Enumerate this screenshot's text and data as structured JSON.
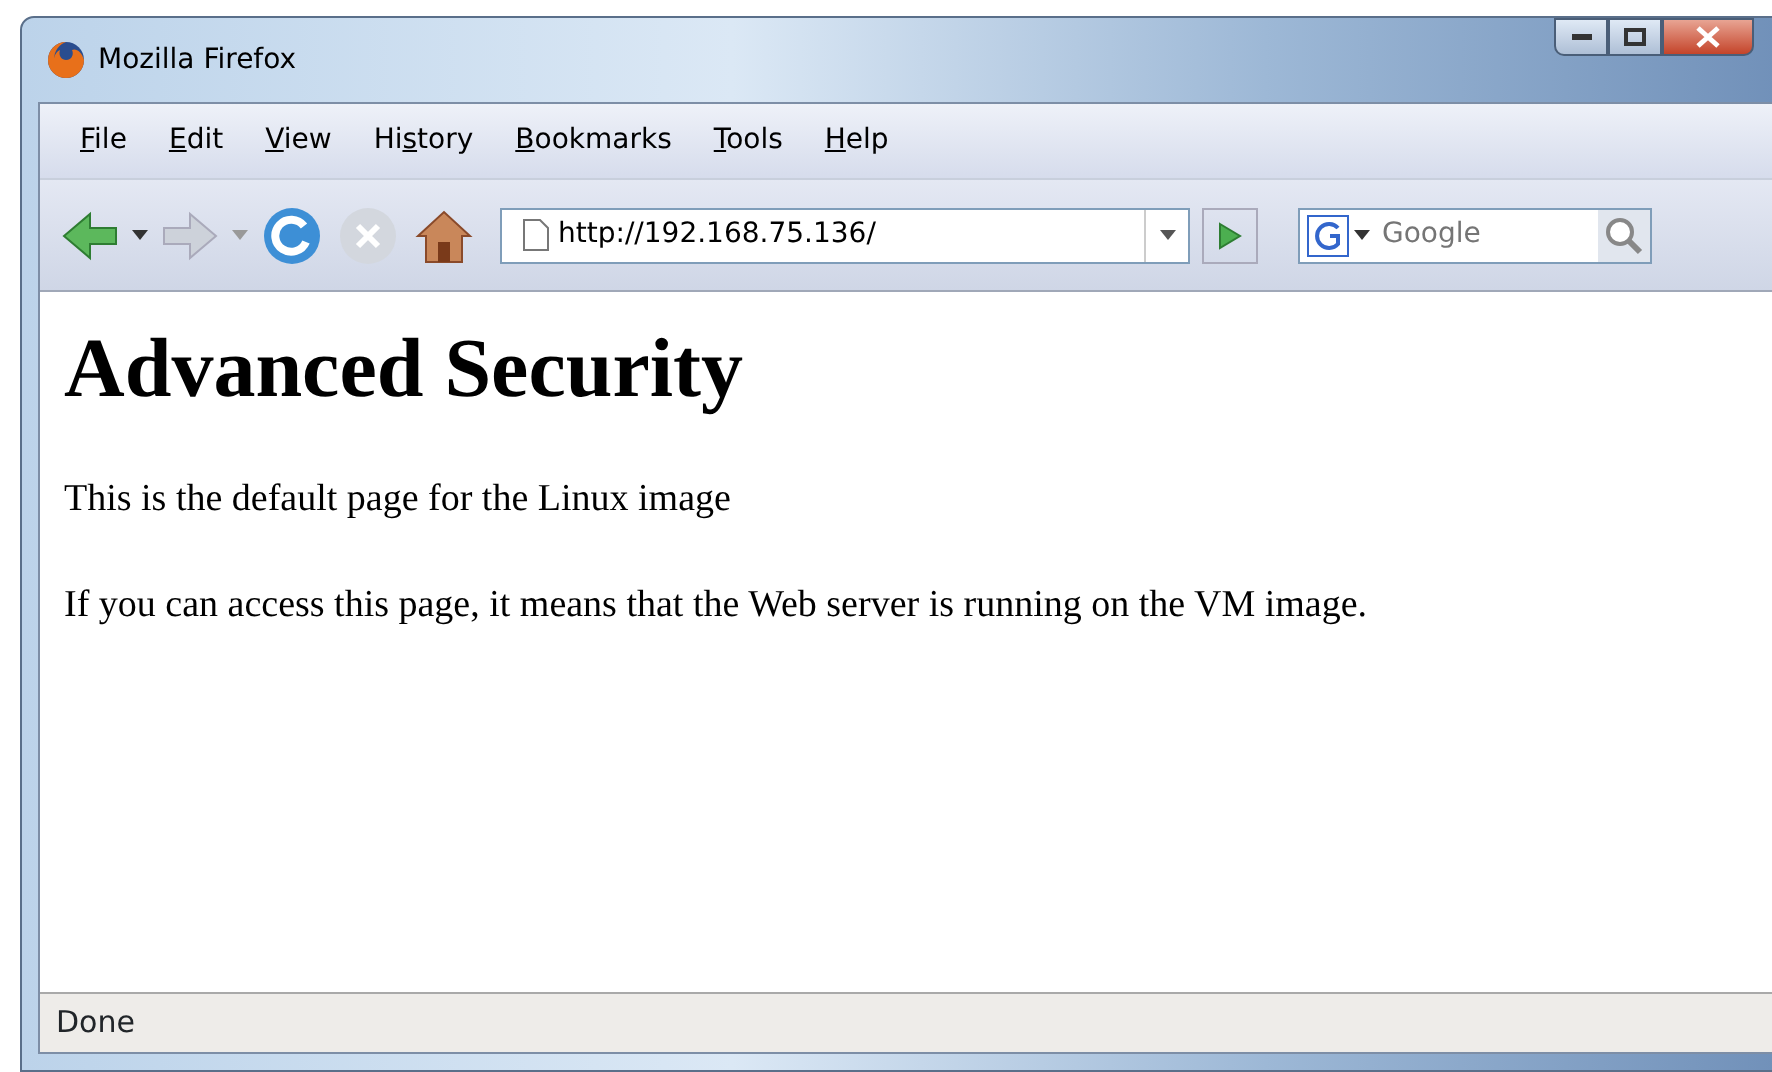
{
  "window": {
    "title": "Mozilla Firefox"
  },
  "menu": [
    {
      "key": "F",
      "after": "ile"
    },
    {
      "key": "E",
      "after": "dit"
    },
    {
      "key": "V",
      "after": "iew"
    },
    {
      "before": "Hi",
      "key": "s",
      "after": "tory"
    },
    {
      "key": "B",
      "after": "ookmarks"
    },
    {
      "key": "T",
      "after": "ools"
    },
    {
      "key": "H",
      "after": "elp"
    }
  ],
  "address": {
    "value": "http://192.168.75.136/"
  },
  "search": {
    "placeholder": "Google"
  },
  "page": {
    "heading": "Advanced Security",
    "paragraphs": [
      "This is the default page for the Linux image",
      "If you can access this page, it means that the Web server is running on the VM image."
    ]
  },
  "status_bar": {
    "text": "Done"
  }
}
